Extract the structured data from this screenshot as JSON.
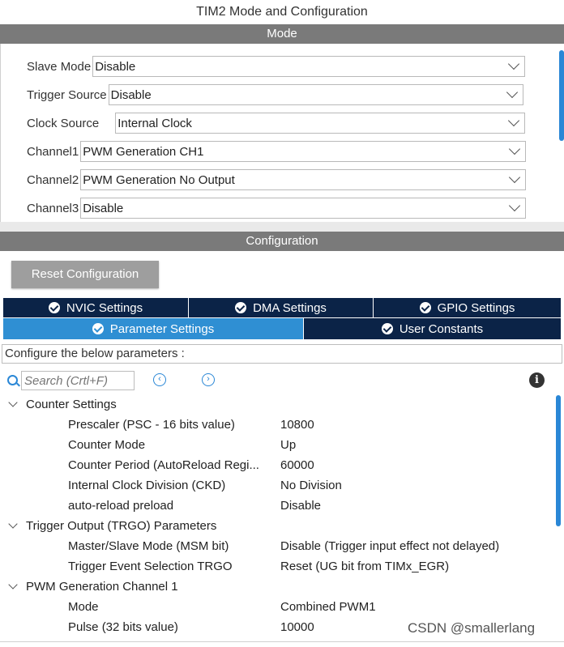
{
  "window": {
    "title": "TIM2 Mode and Configuration"
  },
  "mode_section": {
    "header": "Mode",
    "rows": [
      {
        "label": "Slave Mode",
        "value": "Disable"
      },
      {
        "label": "Trigger Source",
        "value": "Disable"
      },
      {
        "label": "Clock Source",
        "value": "Internal Clock"
      },
      {
        "label": "Channel1",
        "value": "PWM Generation CH1"
      },
      {
        "label": "Channel2",
        "value": "PWM Generation No Output"
      },
      {
        "label": "Channel3",
        "value": "Disable"
      }
    ]
  },
  "config_section": {
    "header": "Configuration",
    "reset_button": "Reset Configuration",
    "tabs_row1": [
      {
        "label": "NVIC Settings"
      },
      {
        "label": "DMA Settings"
      },
      {
        "label": "GPIO Settings"
      }
    ],
    "tabs_row2": [
      {
        "label": "Parameter Settings",
        "active": true
      },
      {
        "label": "User Constants",
        "active": false
      }
    ],
    "description": "Configure the below parameters :",
    "search": {
      "placeholder": "Search (Crtl+F)",
      "prev_icon": "chevron-left-circle-icon",
      "next_icon": "chevron-right-circle-icon"
    },
    "info_icon": "i"
  },
  "parameters": {
    "counter_settings": {
      "label": "Counter Settings",
      "items": [
        {
          "name": "Prescaler (PSC - 16 bits value)",
          "value": "10800"
        },
        {
          "name": "Counter Mode",
          "value": "Up"
        },
        {
          "name": "Counter Period (AutoReload Regi...",
          "value": "60000"
        },
        {
          "name": "Internal Clock Division (CKD)",
          "value": "No Division"
        },
        {
          "name": "auto-reload preload",
          "value": "Disable"
        }
      ]
    },
    "trigger_output": {
      "label": "Trigger Output (TRGO) Parameters",
      "items": [
        {
          "name": "Master/Slave Mode (MSM bit)",
          "value": "Disable (Trigger input effect not delayed)"
        },
        {
          "name": "Trigger Event Selection TRGO",
          "value": "Reset (UG bit from TIMx_EGR)"
        }
      ]
    },
    "pwm_channel1": {
      "label": "PWM Generation Channel 1",
      "items": [
        {
          "name": "Mode",
          "value": "Combined PWM1"
        },
        {
          "name": "Pulse (32 bits value)",
          "value": "10000"
        }
      ]
    }
  },
  "watermark": "CSDN @smallerlang",
  "colors": {
    "tab_dark": "#0b2347",
    "tab_active": "#2f8fd3",
    "header_band": "#7a7a7a",
    "accent": "#2a87d6"
  }
}
